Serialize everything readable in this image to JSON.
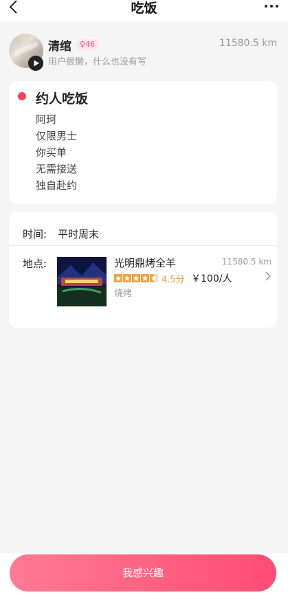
{
  "nav": {
    "title": "吃饭",
    "back_icon": "chevron-left-icon",
    "more_icon": "more-dots-icon"
  },
  "profile": {
    "name": "清绾",
    "badge": "♀46",
    "bio": "用户很懒，什么也没有写",
    "distance": "11580.5 km",
    "play_icon": "play-icon"
  },
  "invite": {
    "title": "约人吃饭",
    "lines": [
      "阿珂",
      "仅限男士",
      "你买单",
      "无需接送",
      "独自赴约"
    ],
    "accent": "#ff4060"
  },
  "details": {
    "time_label": "时间:",
    "time_value": "平时周末",
    "place_label": "地点:",
    "shop": {
      "name": "光明鼎烤全羊",
      "distance": "11580.5 km",
      "rating": 4.5,
      "rating_text": "4.5分",
      "price": "￥100/人",
      "category": "烧烤"
    }
  },
  "cta": {
    "label": "我感兴趣",
    "color": "#ff4d72"
  }
}
